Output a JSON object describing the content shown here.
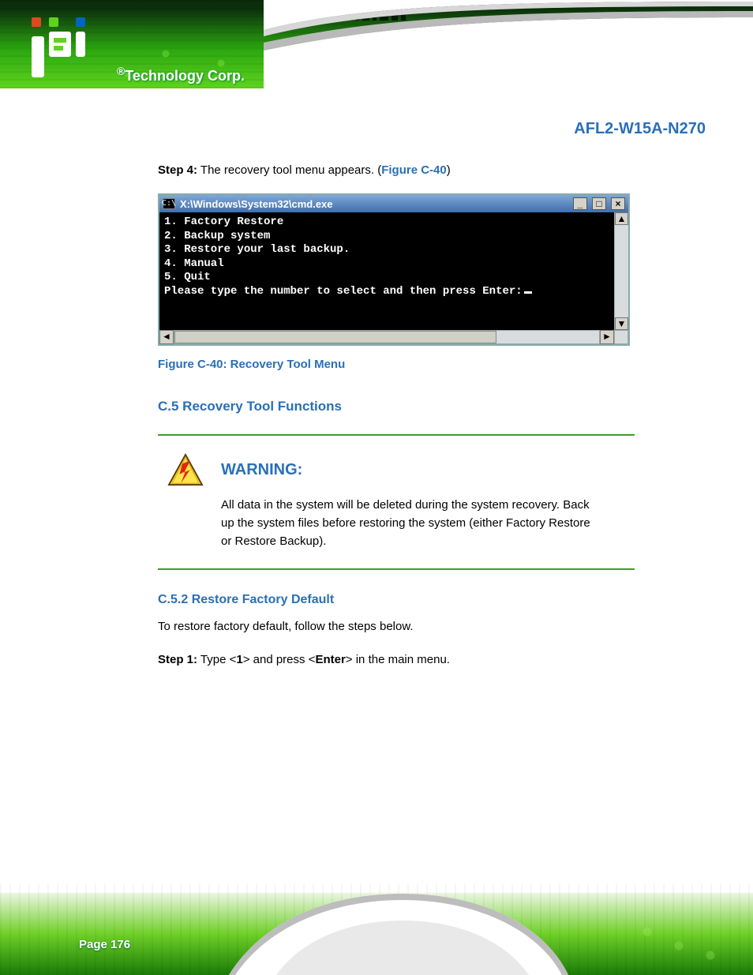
{
  "brand": {
    "logo_text": "®Technology Corp.",
    "product_title": "AFL2-W15A-N270"
  },
  "body": {
    "intro_para": "The recovery tool menu appears. (",
    "intro_fig_ref": "Figure C-40",
    "intro_para_close": ")",
    "step_label": "Step 4:",
    "step_spacer": " "
  },
  "cmd_window": {
    "title": "X:\\Windows\\System32\\cmd.exe",
    "icon_text": "C:\\",
    "btn_min": "_",
    "btn_max": "□",
    "btn_close": "×",
    "lines": [
      "1. Factory Restore",
      "2. Backup system",
      "3. Restore your last backup.",
      "4. Manual",
      "5. Quit",
      "Please type the number to select and then press Enter:"
    ],
    "scroll_up": "▲",
    "scroll_down": "▼",
    "scroll_left": "◄",
    "scroll_right": "►"
  },
  "figure_caption": "Figure C-40: Recovery Tool Menu",
  "subsection": {
    "heading": "C.5.2  Restore Factory Default",
    "para": "To restore factory default, follow the steps below.",
    "list_label": "Step 1:",
    "list_spacer": " ",
    "list_text_lead": "Type <",
    "list_key": "1",
    "list_text_tail": "> and press <",
    "list_key2": "Enter",
    "list_text_close": "> in the main menu."
  },
  "section_heading": "C.5  Recovery Tool Functions",
  "warning": {
    "title": "WARNING:",
    "text": "All data in the system will be deleted during the system recovery. Back up the system files before restoring the system (either Factory Restore or Restore Backup)."
  },
  "page_number": "Page 176"
}
